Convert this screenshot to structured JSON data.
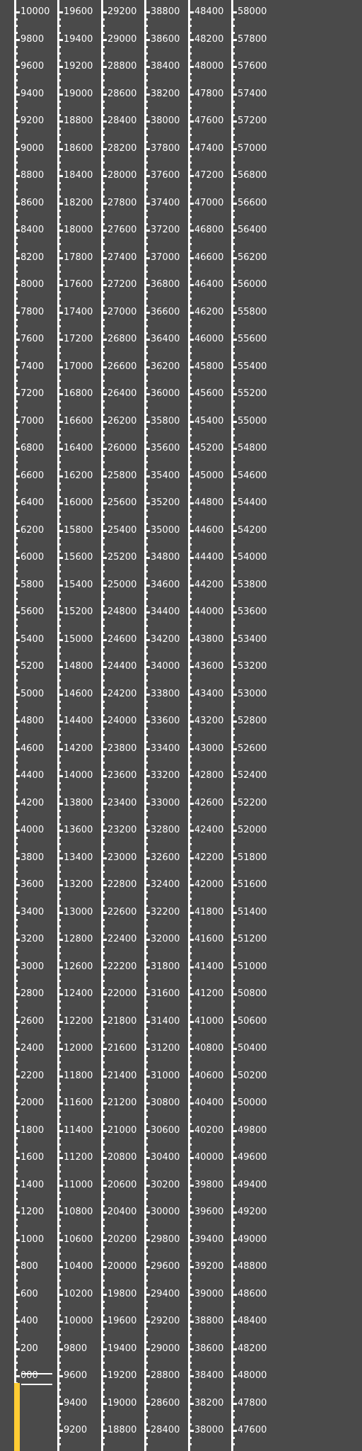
{
  "window": {
    "background": "#4a4a4a"
  },
  "colors": {
    "scale": "#ffffff",
    "progress": "#ffcc33"
  },
  "progress": {
    "value": 0
  },
  "chart_data": {
    "type": "ruler-scale",
    "columns": [
      {
        "first_label_prefix": "",
        "labels": [
          "10000",
          "9800",
          "9600",
          "9400",
          "9200",
          "9000",
          "8800",
          "8600",
          "8400",
          "8200",
          "8000",
          "7800",
          "7600",
          "7400",
          "7200",
          "7000",
          "6800",
          "6600",
          "6400",
          "6200",
          "6000",
          "5800",
          "5600",
          "5400",
          "5200",
          "5000",
          "4800",
          "4600",
          "4400",
          "4200",
          "4000",
          "3800",
          "3600",
          "3400",
          "3200",
          "3000",
          "2800",
          "2600",
          "2400",
          "2200",
          "2000",
          "1800",
          "1600",
          "1400",
          "1200",
          "1000",
          "800",
          "600",
          "400",
          "200",
          "000"
        ]
      },
      {
        "labels": [
          "19600",
          "19400",
          "19200",
          "19000",
          "18800",
          "18600",
          "18400",
          "18200",
          "18000",
          "17800",
          "17600",
          "17400",
          "17200",
          "17000",
          "16800",
          "16600",
          "16400",
          "16200",
          "16000",
          "15800",
          "15600",
          "15400",
          "15200",
          "15000",
          "14800",
          "14600",
          "14400",
          "14200",
          "14000",
          "13800",
          "13600",
          "13400",
          "13200",
          "13000",
          "12800",
          "12600",
          "12400",
          "12200",
          "12000",
          "11800",
          "11600",
          "11400",
          "11200",
          "11000",
          "10800",
          "10600",
          "10400",
          "10200",
          "10000",
          "9800",
          "9600",
          "9400",
          "9200"
        ]
      },
      {
        "labels": [
          "29200",
          "29000",
          "28800",
          "28600",
          "28400",
          "28200",
          "28000",
          "27800",
          "27600",
          "27400",
          "27200",
          "27000",
          "26800",
          "26600",
          "26400",
          "26200",
          "26000",
          "25800",
          "25600",
          "25400",
          "25200",
          "25000",
          "24800",
          "24600",
          "24400",
          "24200",
          "24000",
          "23800",
          "23600",
          "23400",
          "23200",
          "23000",
          "22800",
          "22600",
          "22400",
          "22200",
          "22000",
          "21800",
          "21600",
          "21400",
          "21200",
          "21000",
          "20800",
          "20600",
          "20400",
          "20200",
          "20000",
          "19800",
          "19600",
          "19400",
          "19200",
          "19000",
          "18800"
        ]
      },
      {
        "labels": [
          "38800",
          "38600",
          "38400",
          "38200",
          "38000",
          "37800",
          "37600",
          "37400",
          "37200",
          "37000",
          "36800",
          "36600",
          "36400",
          "36200",
          "36000",
          "35800",
          "35600",
          "35400",
          "35200",
          "35000",
          "34800",
          "34600",
          "34400",
          "34200",
          "34000",
          "33800",
          "33600",
          "33400",
          "33200",
          "33000",
          "32800",
          "32600",
          "32400",
          "32200",
          "32000",
          "31800",
          "31600",
          "31400",
          "31200",
          "31000",
          "30800",
          "30600",
          "30400",
          "30200",
          "30000",
          "29800",
          "29600",
          "29400",
          "29200",
          "29000",
          "28800",
          "28600",
          "28400"
        ]
      },
      {
        "labels": [
          "48400",
          "48200",
          "48000",
          "47800",
          "47600",
          "47400",
          "47200",
          "47000",
          "46800",
          "46600",
          "46400",
          "46200",
          "46000",
          "45800",
          "45600",
          "45400",
          "45200",
          "45000",
          "44800",
          "44600",
          "44400",
          "44200",
          "44000",
          "43800",
          "43600",
          "43400",
          "43200",
          "43000",
          "42800",
          "42600",
          "42400",
          "42200",
          "42000",
          "41800",
          "41600",
          "41400",
          "41200",
          "41000",
          "40800",
          "40600",
          "40400",
          "40200",
          "40000",
          "39800",
          "39600",
          "39400",
          "39200",
          "39000",
          "38800",
          "38600",
          "38400",
          "38200",
          "38000"
        ]
      },
      {
        "labels": [
          "58000",
          "57800",
          "57600",
          "57400",
          "57200",
          "57000",
          "56800",
          "56600",
          "56400",
          "56200",
          "56000",
          "55800",
          "55600",
          "55400",
          "55200",
          "55000",
          "54800",
          "54600",
          "54400",
          "54200",
          "54000",
          "53800",
          "53600",
          "53400",
          "53200",
          "53000",
          "52800",
          "52600",
          "52400",
          "52200",
          "52000",
          "51800",
          "51600",
          "51400",
          "51200",
          "51000",
          "50800",
          "50600",
          "50400",
          "50200",
          "50000",
          "49800",
          "49600",
          "49400",
          "49200",
          "49000",
          "48800",
          "48600",
          "48400",
          "48200",
          "48000",
          "47800",
          "47600"
        ]
      }
    ]
  }
}
